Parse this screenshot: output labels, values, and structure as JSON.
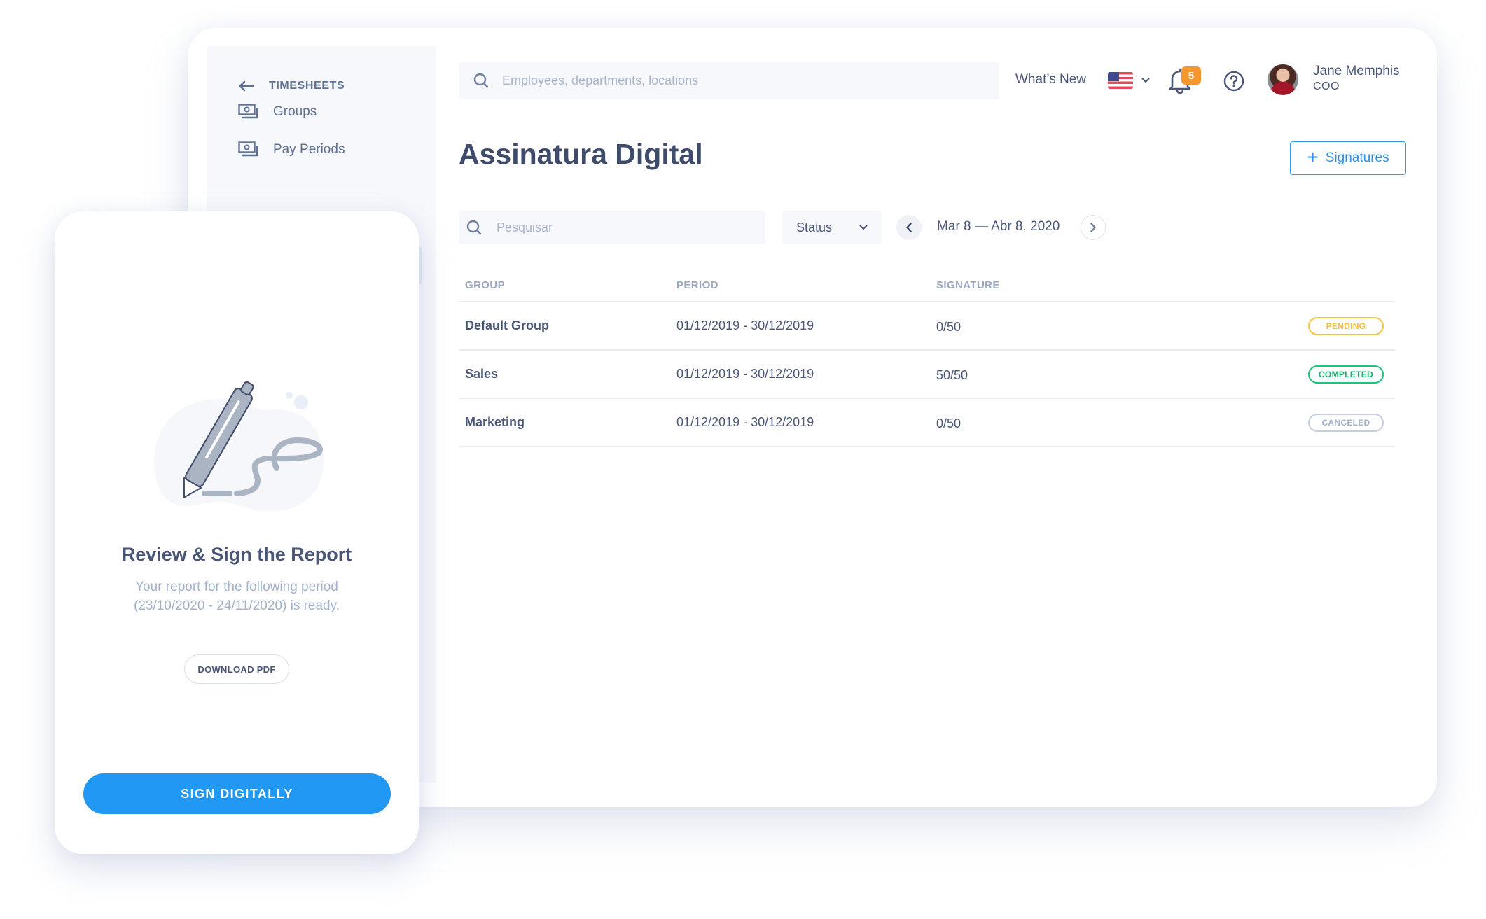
{
  "sidebar": {
    "back_label": "TIMESHEETS",
    "items": [
      {
        "label": "Groups",
        "icon": "money-icon"
      },
      {
        "label": "Pay Periods",
        "icon": "money-icon"
      }
    ]
  },
  "header": {
    "search_placeholder": "Employees, departments, locations",
    "whats_new": "What’s New",
    "language_icon": "us-flag-icon",
    "notifications_count": "5",
    "user": {
      "name": "Jane Memphis",
      "role": "COO"
    }
  },
  "page": {
    "title": "Assinatura Digital",
    "add_button_label": "Signatures"
  },
  "filters": {
    "search_placeholder": "Pesquisar",
    "status_label": "Status",
    "date_range": "Mar 8 — Abr 8, 2020"
  },
  "table": {
    "columns": [
      "GROUP",
      "PERIOD",
      "SIGNATURE",
      ""
    ],
    "rows": [
      {
        "group": "Default Group",
        "period": "01/12/2019 - 30/12/2019",
        "signature": "0/50",
        "status": "PENDING"
      },
      {
        "group": "Sales",
        "period": "01/12/2019 - 30/12/2019",
        "signature": "50/50",
        "status": "COMPLETED"
      },
      {
        "group": "Marketing",
        "period": "01/12/2019 - 30/12/2019",
        "signature": "0/50",
        "status": "CANCELED"
      }
    ],
    "status_colors": {
      "PENDING": "#f5c542",
      "COMPLETED": "#1cc27a",
      "CANCELED": "#c5cee0"
    },
    "status_text_colors": {
      "PENDING": "#f2bd33",
      "COMPLETED": "#14b36d",
      "CANCELED": "#a5b1c8"
    }
  },
  "card": {
    "title": "Review & Sign the Report",
    "description_line1": "Your report for the following period",
    "description_line2": "(23/10/2020 - 24/11/2020) is ready.",
    "download_label": "DOWNLOAD PDF",
    "sign_label": "SIGN DIGITALLY"
  },
  "colors": {
    "accent": "#2298f5",
    "badge": "#f5962f",
    "text": "#4a5678"
  }
}
